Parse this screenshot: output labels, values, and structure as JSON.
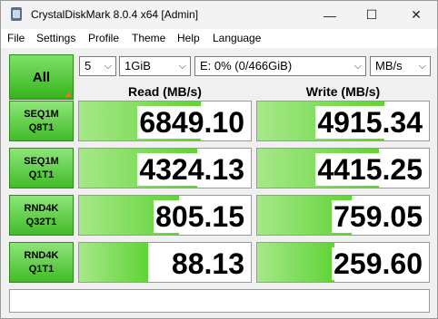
{
  "window": {
    "title": "CrystalDiskMark 8.0.4 x64 [Admin]",
    "controls": {
      "minimize": "—",
      "maximize": "☐",
      "close": "✕"
    }
  },
  "menu": [
    "File",
    "Settings",
    "Profile",
    "Theme",
    "Help",
    "Language"
  ],
  "toolbar": {
    "all_label": "All",
    "count": "5",
    "size": "1GiB",
    "drive": "E: 0% (0/466GiB)",
    "unit": "MB/s"
  },
  "headers": {
    "read": "Read (MB/s)",
    "write": "Write (MB/s)"
  },
  "tests": [
    {
      "line1": "SEQ1M",
      "line2": "Q8T1",
      "read": "6849.10",
      "write": "4915.34",
      "read_fill": 0.71,
      "write_fill": 0.74
    },
    {
      "line1": "SEQ1M",
      "line2": "Q1T1",
      "read": "4324.13",
      "write": "4415.25",
      "read_fill": 0.69,
      "write_fill": 0.71
    },
    {
      "line1": "RND4K",
      "line2": "Q32T1",
      "read": "805.15",
      "write": "759.05",
      "read_fill": 0.58,
      "write_fill": 0.55
    },
    {
      "line1": "RND4K",
      "line2": "Q1T1",
      "read": "88.13",
      "write": "259.60",
      "read_fill": 0.4,
      "write_fill": 0.45
    }
  ],
  "colors": {
    "accent_green": "#42bb29",
    "bar_green": "#5fd337",
    "corner_orange": "#e07a1c"
  },
  "icons": [
    "app-icon",
    "chevron-down-icon"
  ]
}
